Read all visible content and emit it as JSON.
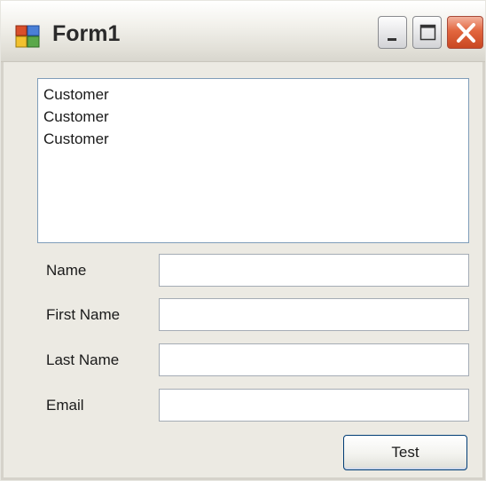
{
  "window": {
    "title": "Form1",
    "controls": [
      "minimize",
      "maximize",
      "close"
    ]
  },
  "listbox": {
    "items": [
      "Customer",
      "Customer",
      "Customer"
    ]
  },
  "form": {
    "fields": [
      {
        "label": "Name",
        "value": ""
      },
      {
        "label": "First Name",
        "value": ""
      },
      {
        "label": "Last Name",
        "value": ""
      },
      {
        "label": "Email",
        "value": ""
      }
    ],
    "button_label": "Test"
  },
  "icons": {
    "app": "app-form-icon",
    "minimize": "minimize-icon",
    "maximize": "maximize-icon",
    "close": "close-icon"
  },
  "colors": {
    "window_bg": "#eceae3",
    "close_button": "#e2663e",
    "list_border": "#7f9db9",
    "button_border": "#003c74"
  }
}
